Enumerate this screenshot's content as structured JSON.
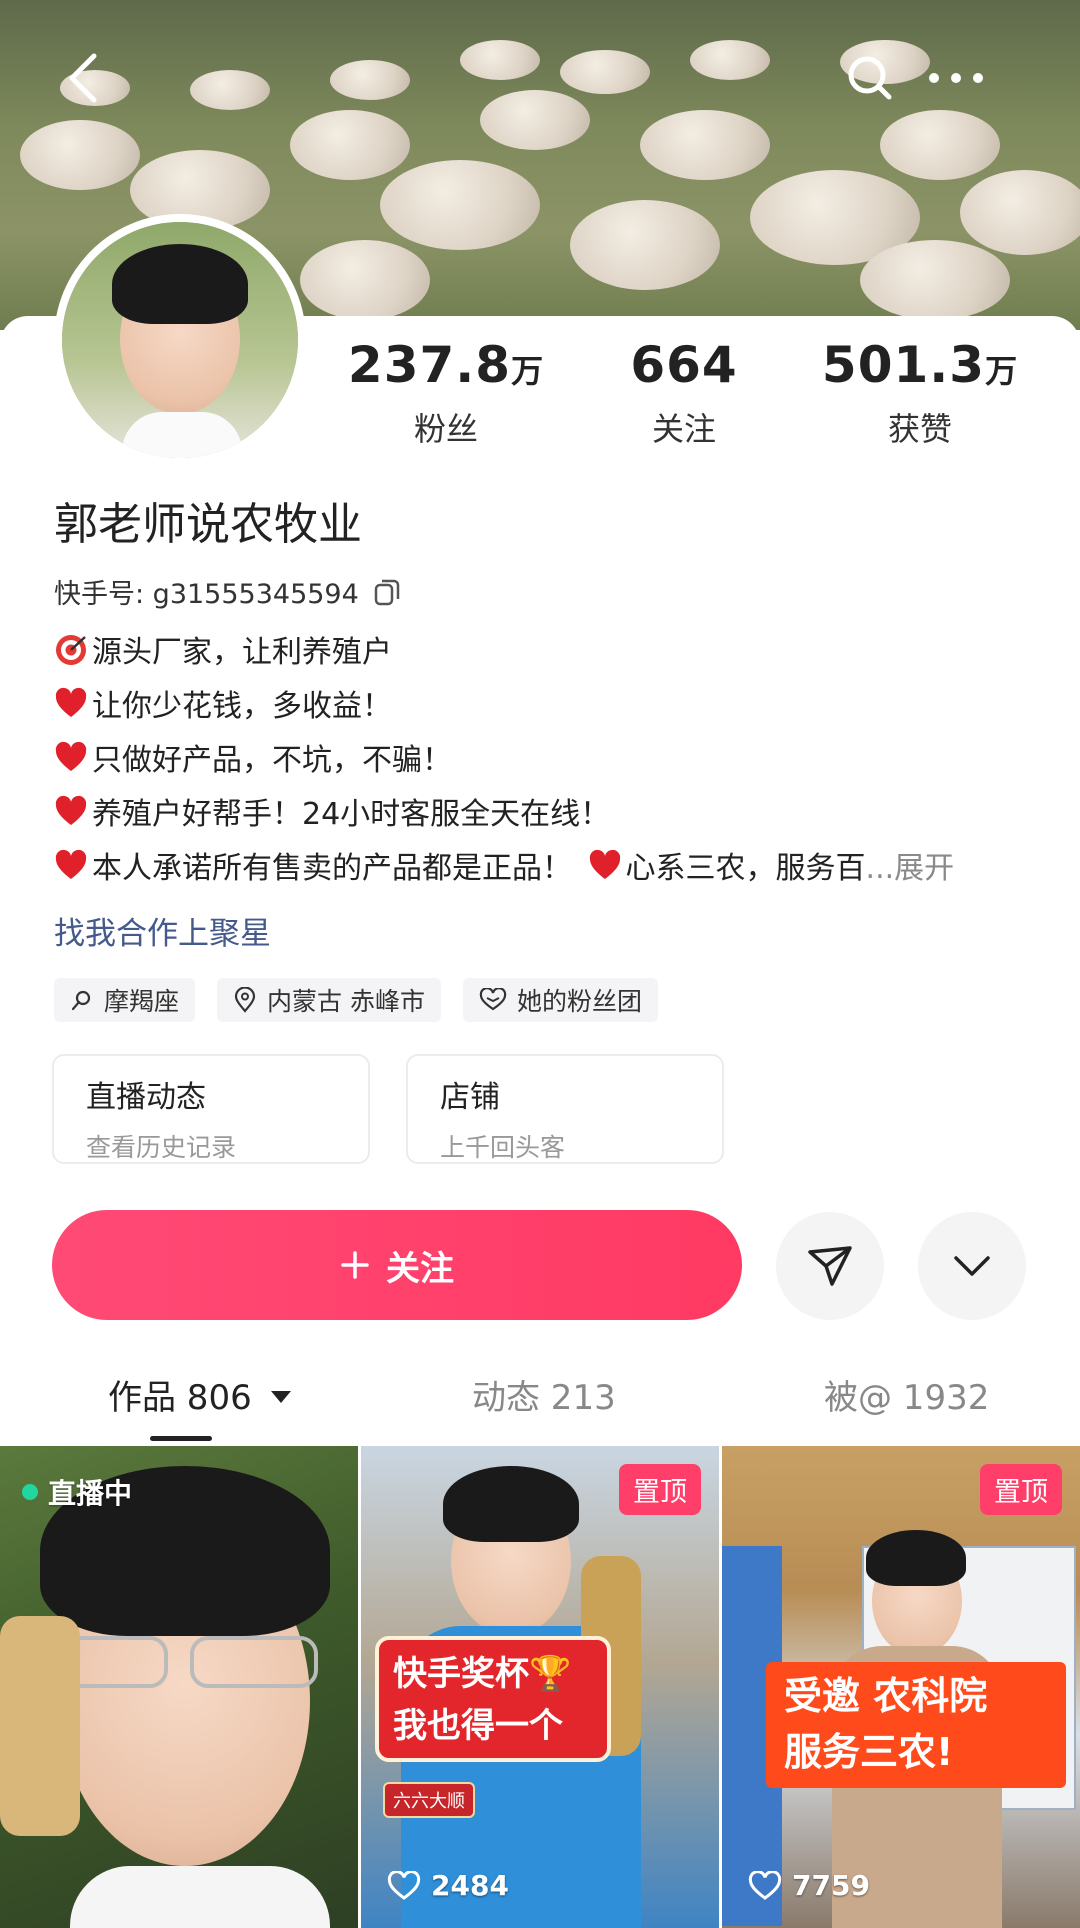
{
  "profile": {
    "stats": [
      {
        "value": "237.8",
        "unit": "万",
        "label": "粉丝"
      },
      {
        "value": "664",
        "unit": "",
        "label": "关注"
      },
      {
        "value": "501.3",
        "unit": "万",
        "label": "获赞"
      }
    ],
    "name": "郭老师说农牧业",
    "kuaishou_id": "快手号: g31555345594",
    "bio": [
      {
        "icon": "target-icon",
        "text": "源头厂家，让利养殖户"
      },
      {
        "icon": "heart-icon",
        "text": "让你少花钱，多收益！"
      },
      {
        "icon": "heart-icon",
        "text": "只做好产品，不坑，不骗！"
      },
      {
        "icon": "heart-icon",
        "text": "养殖户好帮手！24小时客服全天在线！"
      },
      {
        "icon": "heart-icon",
        "text": "本人承诺所有售卖的产品都是正品！",
        "text2": "心系三农，服务百",
        "more": "...展开"
      }
    ],
    "cooperation": "找我合作上聚星",
    "tags": [
      {
        "icon": "zodiac-icon",
        "label": "摩羯座"
      },
      {
        "icon": "location-pin-icon",
        "label": "内蒙古 赤峰市"
      },
      {
        "icon": "fan-club-icon",
        "label": "她的粉丝团"
      }
    ],
    "entries": [
      {
        "title": "直播动态",
        "subtitle": "查看历史记录"
      },
      {
        "title": "店铺",
        "subtitle": "上千回头客"
      }
    ],
    "follow_label": "关注"
  },
  "tabs": [
    {
      "label": "作品 806",
      "active": true
    },
    {
      "label": "动态 213",
      "active": false
    },
    {
      "label": "被@ 1932",
      "active": false
    }
  ],
  "videos": [
    {
      "badge": "直播中",
      "likes": ""
    },
    {
      "badge": "置顶",
      "caption_lines": [
        "快手奖杯🏆",
        "我也得一个"
      ],
      "sub_caption": "六六大顺",
      "likes": "2484"
    },
    {
      "badge": "置顶",
      "caption_lines": [
        "受邀 农科院",
        "服务三农!"
      ],
      "likes": "7759"
    }
  ],
  "colors": {
    "accent": "#ff3a63",
    "link": "#455a8c",
    "live_dot": "#22d6a0"
  }
}
